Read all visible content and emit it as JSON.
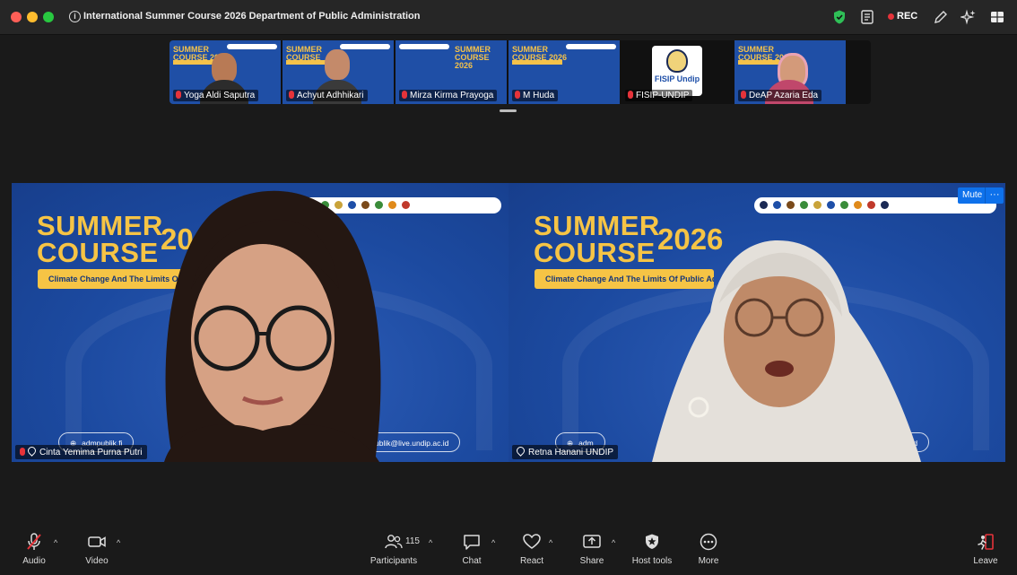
{
  "window": {
    "title": "International Summer Course 2026 Department of Public Administration",
    "rec_label": "REC"
  },
  "thumbnails": [
    {
      "name": "Yoga Aldi Saputra",
      "muted": true,
      "bg_title": "SUMMER\nCOURSE 2026",
      "skin": "#b87a55",
      "shirt": "#2c2c2c"
    },
    {
      "name": "Achyut Adhhikari",
      "muted": true,
      "bg_title": "SUMMER\nCOURSE",
      "skin": "#c48a6a",
      "shirt": "#3a3a3a"
    },
    {
      "name": "Mirza Kirma Prayoga",
      "muted": true,
      "bg_title": "SUMMER\nCOURSE 2026",
      "skin": "",
      "shirt": ""
    },
    {
      "name": "M Huda",
      "muted": true,
      "bg_title": "SUMMER\nCOURSE 2026",
      "skin": "",
      "shirt": ""
    },
    {
      "name": "FISIP-UNDIP",
      "muted": true,
      "logo_text": "FISIP Undip"
    },
    {
      "name": "DeAP Azaria Eda",
      "muted": true,
      "bg_title": "SUMMER\nCOURSE 2026",
      "skin": "#d39a7a",
      "shirt": "#c0476b"
    }
  ],
  "main_tiles": [
    {
      "name": "Cinta Yemima Purna Putri",
      "muted": true,
      "pinned": true,
      "bg_title": "SUMMER\nCOURSE",
      "bg_year": "20",
      "banner": "Climate Change And The Limits Of P",
      "footer_left": "admpublik.fi",
      "footer_right": "ublik@live.undip.ac.id"
    },
    {
      "name": "Retna Hanani UNDIP",
      "muted": false,
      "pinned": true,
      "active_speaker": true,
      "bg_title": "SUMMER\nCOURSE",
      "bg_year": "2026",
      "banner": "Climate Change And The Limits Of Public Administ",
      "footer_left": "adm",
      "footer_right": "undip.ac.id",
      "mute_label": "Mute",
      "more_label": "···"
    }
  ],
  "toolbar": {
    "audio": "Audio",
    "video": "Video",
    "participants": "Participants",
    "participants_count": "115",
    "chat": "Chat",
    "react": "React",
    "share": "Share",
    "host_tools": "Host tools",
    "more": "More",
    "leave": "Leave"
  },
  "colors": {
    "active_speaker_outline": "#3ecf57",
    "brand_blue": "#0e71eb",
    "rec_red": "#e5333a",
    "summer_yellow": "#f6c445"
  }
}
